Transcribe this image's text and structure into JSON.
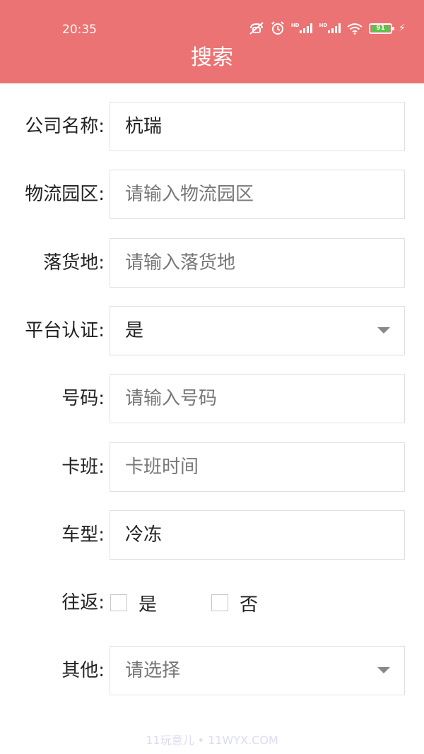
{
  "status_bar": {
    "time": "20:35",
    "icons": [
      "mute-icon",
      "alarm-icon",
      "hd-signal-icon",
      "hd-signal-icon",
      "wifi-icon",
      "battery-icon",
      "charging-icon"
    ],
    "battery": "91",
    "hd_label": "HD",
    "bolt_glyph": "⚡"
  },
  "header": {
    "title": "搜索",
    "color": "#ec7373"
  },
  "form": {
    "company": {
      "label": "公司名称:",
      "value": "杭瑞"
    },
    "park": {
      "label": "物流园区:",
      "placeholder": "请输入物流园区"
    },
    "destination": {
      "label": "落货地:",
      "placeholder": "请输入落货地"
    },
    "certification": {
      "label": "平台认证:",
      "value": "是"
    },
    "number": {
      "label": "号码:",
      "placeholder": "请输入号码"
    },
    "schedule": {
      "label": "卡班:",
      "placeholder": "卡班时间"
    },
    "vehicle": {
      "label": "车型:",
      "value": "冷冻"
    },
    "round_trip": {
      "label": "往返:",
      "options": [
        "是",
        "否"
      ]
    },
    "other": {
      "label": "其他:",
      "placeholder": "请选择"
    }
  },
  "watermark": "11玩意儿 • 11WYX.COM"
}
